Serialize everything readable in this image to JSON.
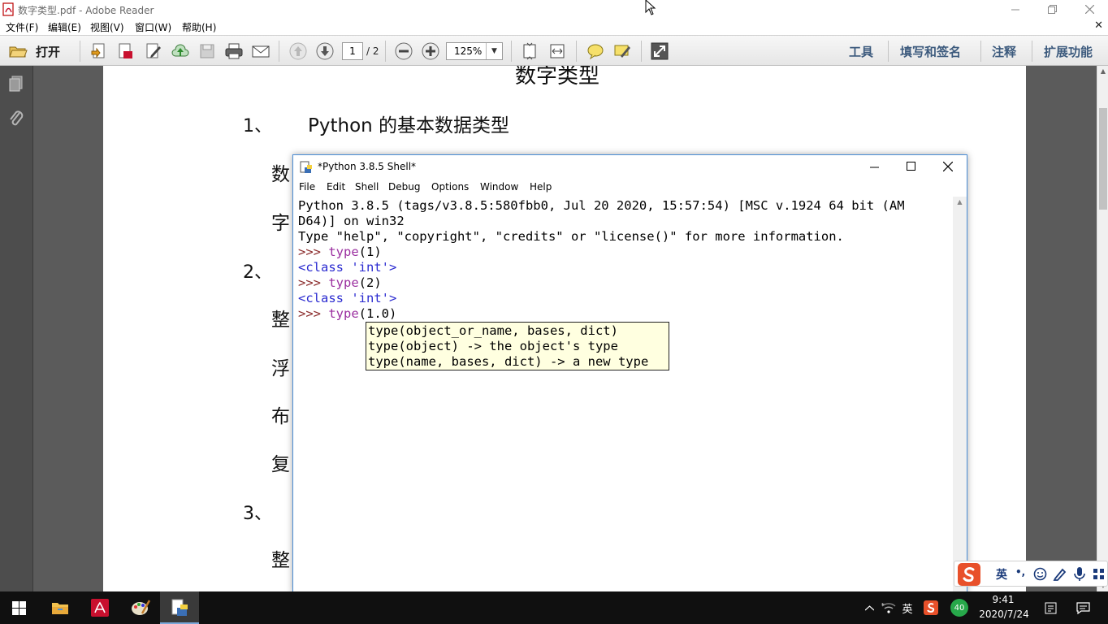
{
  "adobe": {
    "window_title": "数字类型.pdf - Adobe Reader",
    "menu": [
      "文件(F)",
      "编辑(E)",
      "视图(V)",
      "窗口(W)",
      "帮助(H)"
    ],
    "toolbar": {
      "open_label": "打开",
      "page_current": "1",
      "page_total": "/ 2",
      "zoom": "125%",
      "right_tabs": [
        "工具",
        "填写和签名",
        "注释",
        "扩展功能"
      ]
    }
  },
  "pdf": {
    "heading": "数字类型",
    "section1": "1、",
    "section1_title": "Python 的基本数据类型",
    "left_chars": [
      "数",
      "字",
      "整",
      "浮",
      "布",
      "复",
      "整"
    ],
    "section2": "2、",
    "section3": "3、"
  },
  "shell": {
    "title": "*Python 3.8.5 Shell*",
    "menu": [
      "File",
      "Edit",
      "Shell",
      "Debug",
      "Options",
      "Window",
      "Help"
    ],
    "banner1": "Python 3.8.5 (tags/v3.8.5:580fbb0, Jul 20 2020, 15:57:54) [MSC v.1924 64 bit (AM",
    "banner2": "D64)] on win32",
    "banner3": "Type \"help\", \"copyright\", \"credits\" or \"license()\" for more information.",
    "prompt": ">>> ",
    "fn": "type",
    "arg1": "(1)",
    "out1": "<class 'int'>",
    "arg2": "(2)",
    "out2": "<class 'int'>",
    "arg3": "(1.0)",
    "calltip": [
      "type(object_or_name, bases, dict)",
      "type(object) -> the object's type",
      "type(name, bases, dict) -> a new type"
    ]
  },
  "ime": {
    "mode": "英",
    "punct": "•,"
  },
  "taskbar": {
    "tray_lang": "英",
    "badge": "40",
    "time": "9:41",
    "date": "2020/7/24"
  },
  "colors": {
    "accent": "#4b8dd6",
    "adobe_red": "#c8102e",
    "prompt": "#8b2b2b",
    "builtin": "#9b2fa0",
    "output": "#2a2ad0",
    "calltip_bg": "#ffffe0"
  }
}
